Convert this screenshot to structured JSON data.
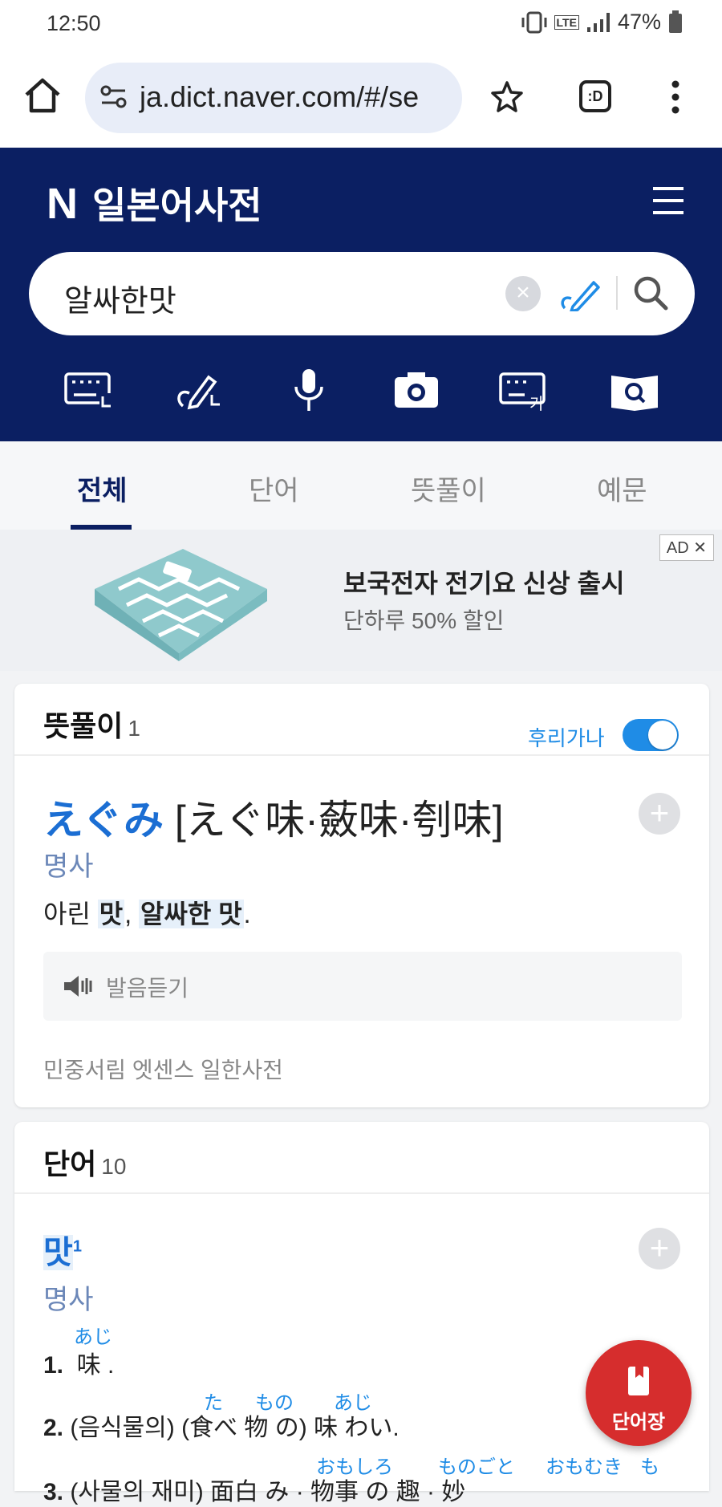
{
  "status": {
    "time": "12:50",
    "battery": "47%",
    "network": "LTE"
  },
  "browser": {
    "url": "ja.dict.naver.com/#/se",
    "tabs_label": ":D"
  },
  "header": {
    "logo_letter": "N",
    "title": "일본어사전"
  },
  "search": {
    "query": "알싸한맛",
    "clear_label": "×"
  },
  "tools": [
    {
      "name": "keyboard-icon"
    },
    {
      "name": "handwriting-icon"
    },
    {
      "name": "microphone-icon"
    },
    {
      "name": "camera-icon"
    },
    {
      "name": "hangul-keyboard-icon"
    },
    {
      "name": "book-search-icon"
    }
  ],
  "tabs": [
    {
      "label": "전체",
      "active": true
    },
    {
      "label": "단어",
      "active": false
    },
    {
      "label": "뜻풀이",
      "active": false
    },
    {
      "label": "예문",
      "active": false
    }
  ],
  "ad": {
    "badge": "AD",
    "close": "✕",
    "title": "보국전자 전기요 신상 출시",
    "subtitle": "단하루 50% 할인"
  },
  "meaning_section": {
    "title": "뜻풀이",
    "count": "1",
    "furigana_label": "후리가나",
    "furigana_on": true,
    "entry": {
      "kana": "えぐみ",
      "kanji": " [えぐ味·蘞味·刳味]",
      "pos": "명사",
      "meaning_prefix": "아린 ",
      "meaning_hl1": "맛",
      "meaning_mid": ", ",
      "meaning_hl2": "알싸한 맛",
      "meaning_suffix": ".",
      "listen_label": "발음듣기",
      "source": "민중서림 엣센스 일한사전",
      "plus": "+"
    }
  },
  "word_section": {
    "title": "단어",
    "count": "10",
    "word": "맛",
    "word_sup": "1",
    "pos": "명사",
    "plus": "+",
    "defs": [
      {
        "num": "1.",
        "text": "味 .",
        "ruby": [
          "あじ"
        ]
      },
      {
        "num": "2.",
        "text": "(음식물의) (食べ 物 の) 味 わい.",
        "ruby": [
          "た",
          "もの",
          "あじ"
        ]
      },
      {
        "num": "3.",
        "text": "(사물의 재미) 面白 み · 物事 の 趣 · 妙",
        "ruby": [
          "おもしろ",
          "ものごと",
          "おもむき",
          "も"
        ]
      }
    ]
  },
  "fab": {
    "label": "단어장"
  }
}
